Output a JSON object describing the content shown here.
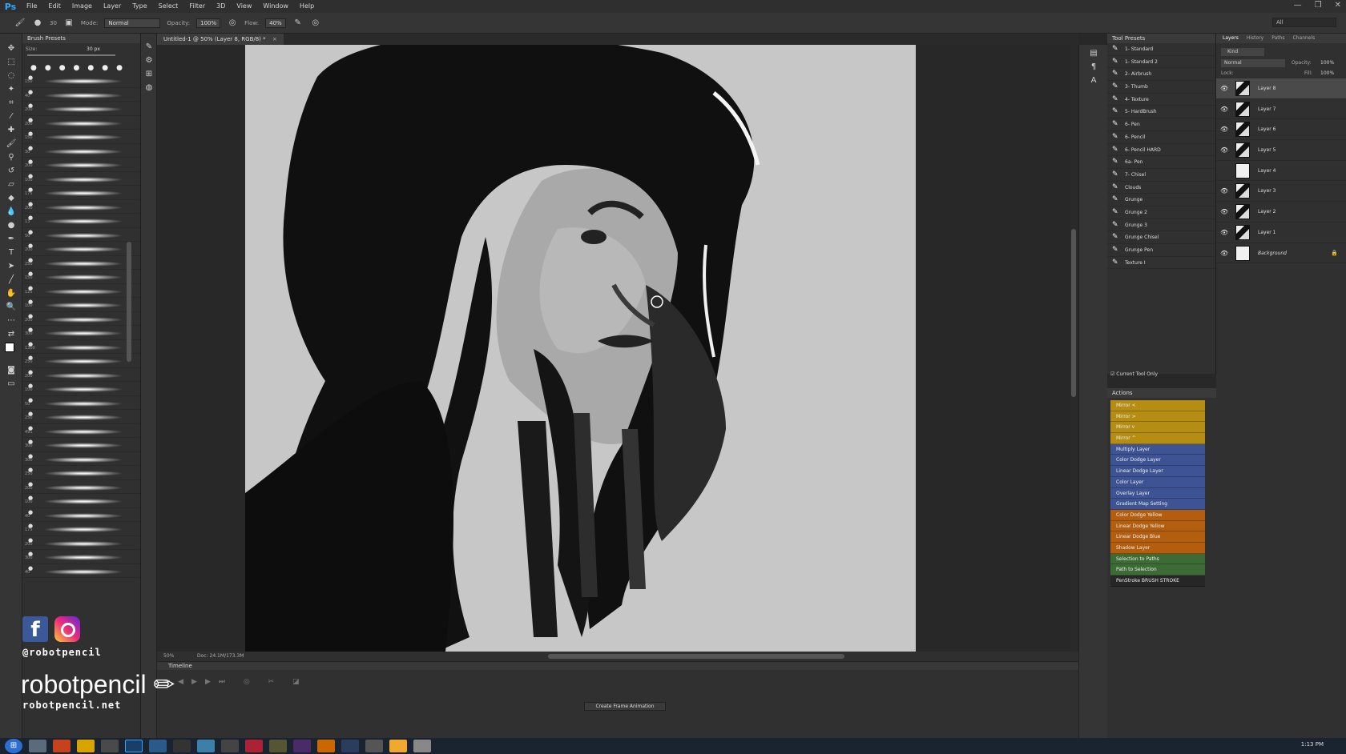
{
  "app": {
    "logo": "Ps",
    "menu": [
      "File",
      "Edit",
      "Image",
      "Layer",
      "Type",
      "Select",
      "Filter",
      "3D",
      "View",
      "Window",
      "Help"
    ],
    "window_controls": [
      "—",
      "❐",
      "✕"
    ]
  },
  "options": {
    "size": "30",
    "mode_label": "Mode:",
    "mode_value": "Normal",
    "opacity_label": "Opacity:",
    "opacity_value": "100%",
    "flow_label": "Flow:",
    "flow_value": "40%",
    "workspace": "All"
  },
  "brush_panel": {
    "title": "Brush Presets",
    "size_label": "Size:",
    "size_value": "30 px",
    "sizes": [
      "150",
      "40",
      "200",
      "200",
      "150",
      "30",
      "200",
      "100",
      "175",
      "200",
      "13",
      "50",
      "200",
      "250",
      "150",
      "125",
      "100",
      "200",
      "300",
      "1300",
      "250",
      "200",
      "100",
      "50",
      "250",
      "491",
      "300",
      "300",
      "250",
      "200",
      "100",
      "40",
      "175",
      "200",
      "300",
      "40"
    ]
  },
  "document": {
    "tab_title": "Untitled-1 @ 50% (Layer 8, RGB/8) *",
    "zoom": "50%",
    "doc_size": "Doc: 24.1M/173.3M"
  },
  "timeline": {
    "title": "Timeline",
    "create_button": "Create Frame Animation"
  },
  "tool_presets": {
    "title": "Tool Presets",
    "items": [
      "1- Standard",
      "1- Standard 2",
      "2- Airbrush",
      "3- Thumb",
      "4- Texture",
      "5- HardBrush",
      "6- Pen",
      "6- Pencil",
      "6- Pencil HARD",
      "6a- Pen",
      "7- Chisel",
      "Clouds",
      "Grunge",
      "Grunge 2",
      "Grunge 3",
      "Grunge Chisel",
      "Grunge Pen",
      "Texture I"
    ],
    "current_tool_only": "Current Tool Only"
  },
  "actions": {
    "title": "Actions",
    "items": [
      {
        "label": "Mirror <",
        "color": "#b58d13"
      },
      {
        "label": "Mirror >",
        "color": "#b58d13"
      },
      {
        "label": "Mirror v",
        "color": "#b58d13"
      },
      {
        "label": "Mirror ^",
        "color": "#b58d13"
      },
      {
        "label": "Multiply Layer",
        "color": "#3d5394"
      },
      {
        "label": "Color Dodge Layer",
        "color": "#3d5394"
      },
      {
        "label": "Linear Dodge Layer",
        "color": "#3d5394"
      },
      {
        "label": "Color Layer",
        "color": "#3d5394"
      },
      {
        "label": "Overlay Layer",
        "color": "#3d5394"
      },
      {
        "label": "Gradient Map Setting",
        "color": "#3d5394"
      },
      {
        "label": "Color Dodge Yellow",
        "color": "#b25e0e"
      },
      {
        "label": "Linear Dodge Yellow",
        "color": "#b25e0e"
      },
      {
        "label": "Linear Dodge Blue",
        "color": "#b25e0e"
      },
      {
        "label": "Shadow Layer",
        "color": "#b25e0e"
      },
      {
        "label": "Selection to Paths",
        "color": "#3c6b36"
      },
      {
        "label": "Path to Selection",
        "color": "#3c6b36"
      },
      {
        "label": "PenStroke BRUSH STROKE",
        "color": "#262626"
      }
    ]
  },
  "layers": {
    "tabs": [
      "Layers",
      "History",
      "Paths",
      "Channels"
    ],
    "kind": "Kind",
    "blend": "Normal",
    "opacity_label": "Opacity:",
    "opacity": "100%",
    "lock_label": "Lock:",
    "fill_label": "Fill:",
    "fill": "100%",
    "items": [
      {
        "name": "Layer 8",
        "visible": true,
        "selected": true
      },
      {
        "name": "Layer 7",
        "visible": true
      },
      {
        "name": "Layer 6",
        "visible": true
      },
      {
        "name": "Layer 5",
        "visible": true
      },
      {
        "name": "Layer 4",
        "visible": false
      },
      {
        "name": "Layer 3",
        "visible": true
      },
      {
        "name": "Layer 2",
        "visible": true
      },
      {
        "name": "Layer 1",
        "visible": true
      },
      {
        "name": "Background",
        "visible": true,
        "locked": true
      }
    ]
  },
  "watermark": {
    "handle": "@robotpencil",
    "brand": "robotpencil",
    "url": "robotpencil.net"
  },
  "taskbar": {
    "clock": "1:13 PM"
  }
}
